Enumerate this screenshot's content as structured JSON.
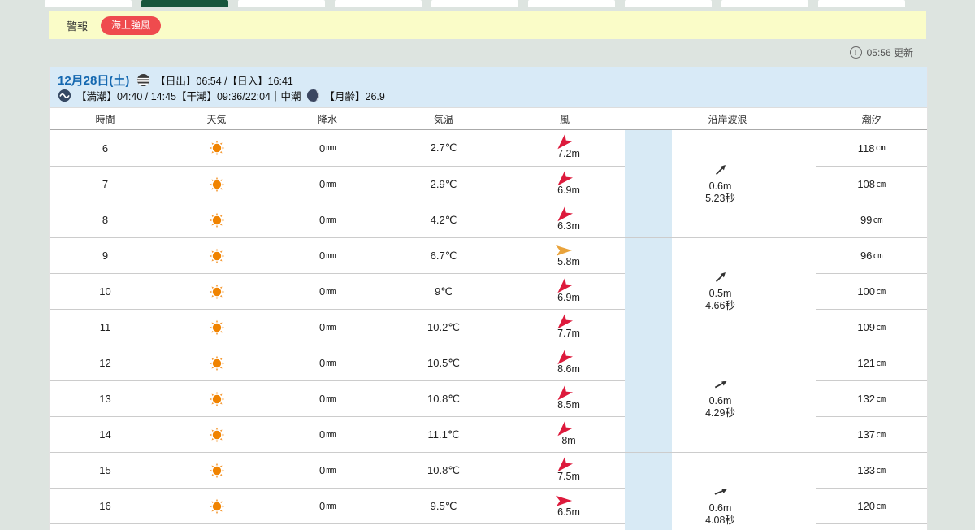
{
  "tabs": {
    "items": [
      {
        "active": false
      },
      {
        "active": true
      },
      {
        "active": false
      },
      {
        "active": false
      },
      {
        "active": false
      },
      {
        "active": false
      },
      {
        "active": false
      },
      {
        "active": false
      },
      {
        "active": false
      }
    ]
  },
  "alert": {
    "label": "警報",
    "badge": "海上強風"
  },
  "update": {
    "text": "05:56 更新"
  },
  "date_header": {
    "date": "12月28日(土)",
    "sun_times": "【日出】06:54 /【日入】16:41",
    "tide_times": "【満潮】04:40 / 14:45【干潮】09:36/22:04｜中潮",
    "moon": "【月齢】26.9"
  },
  "table": {
    "columns": [
      "時間",
      "天気",
      "降水",
      "気温",
      "風",
      "沿岸波浪",
      "潮汐"
    ],
    "rows": [
      {
        "hour": "6",
        "weather": "sunny",
        "precip": "0",
        "precip_unit": "mm",
        "temp": "2.7℃",
        "wind_speed": "7.2m",
        "wind_direction": "southwest",
        "wind_rotate_deg": 135,
        "wind_color": "#dd1a3c",
        "tide": "118",
        "tide_unit": "cm"
      },
      {
        "hour": "7",
        "weather": "sunny",
        "precip": "0",
        "precip_unit": "mm",
        "temp": "2.9℃",
        "wind_speed": "6.9m",
        "wind_direction": "southwest",
        "wind_rotate_deg": 135,
        "wind_color": "#dd1a3c",
        "tide": "108",
        "tide_unit": "cm"
      },
      {
        "hour": "8",
        "weather": "sunny",
        "precip": "0",
        "precip_unit": "mm",
        "temp": "4.2℃",
        "wind_speed": "6.3m",
        "wind_direction": "southwest",
        "wind_rotate_deg": 135,
        "wind_color": "#dd1a3c",
        "tide": "99",
        "tide_unit": "cm"
      },
      {
        "hour": "9",
        "weather": "sunny",
        "precip": "0",
        "precip_unit": "mm",
        "temp": "6.7℃",
        "wind_speed": "5.8m",
        "wind_direction": "east",
        "wind_rotate_deg": 0,
        "wind_color": "#e9a33b",
        "tide": "96",
        "tide_unit": "cm"
      },
      {
        "hour": "10",
        "weather": "sunny",
        "precip": "0",
        "precip_unit": "mm",
        "temp": "9℃",
        "wind_speed": "6.9m",
        "wind_direction": "southwest",
        "wind_rotate_deg": 135,
        "wind_color": "#dd1a3c",
        "tide": "100",
        "tide_unit": "cm"
      },
      {
        "hour": "11",
        "weather": "sunny",
        "precip": "0",
        "precip_unit": "mm",
        "temp": "10.2℃",
        "wind_speed": "7.7m",
        "wind_direction": "southwest",
        "wind_rotate_deg": 135,
        "wind_color": "#dd1a3c",
        "tide": "109",
        "tide_unit": "cm"
      },
      {
        "hour": "12",
        "weather": "sunny",
        "precip": "0",
        "precip_unit": "mm",
        "temp": "10.5℃",
        "wind_speed": "8.6m",
        "wind_direction": "southwest",
        "wind_rotate_deg": 135,
        "wind_color": "#dd1a3c",
        "tide": "121",
        "tide_unit": "cm"
      },
      {
        "hour": "13",
        "weather": "sunny",
        "precip": "0",
        "precip_unit": "mm",
        "temp": "10.8℃",
        "wind_speed": "8.5m",
        "wind_direction": "southwest",
        "wind_rotate_deg": 135,
        "wind_color": "#dd1a3c",
        "tide": "132",
        "tide_unit": "cm"
      },
      {
        "hour": "14",
        "weather": "sunny",
        "precip": "0",
        "precip_unit": "mm",
        "temp": "11.1℃",
        "wind_speed": "8m",
        "wind_direction": "southwest",
        "wind_rotate_deg": 135,
        "wind_color": "#dd1a3c",
        "tide": "137",
        "tide_unit": "cm"
      },
      {
        "hour": "15",
        "weather": "sunny",
        "precip": "0",
        "precip_unit": "mm",
        "temp": "10.8℃",
        "wind_speed": "7.5m",
        "wind_direction": "southwest",
        "wind_rotate_deg": 135,
        "wind_color": "#dd1a3c",
        "tide": "133",
        "tide_unit": "cm"
      },
      {
        "hour": "16",
        "weather": "sunny",
        "precip": "0",
        "precip_unit": "mm",
        "temp": "9.5℃",
        "wind_speed": "6.5m",
        "wind_direction": "east",
        "wind_rotate_deg": 0,
        "wind_color": "#dd1a3c",
        "tide": "120",
        "tide_unit": "cm"
      }
    ],
    "wave_groups": [
      {
        "height": "0.6m",
        "period": "5.23秒",
        "direction": "northeast",
        "angle_deg_from_east": 45
      },
      {
        "height": "0.5m",
        "period": "4.66秒",
        "direction": "northeast",
        "angle_deg_from_east": 45
      },
      {
        "height": "0.6m",
        "period": "4.29秒",
        "direction": "east-northeast",
        "angle_deg_from_east": 28
      },
      {
        "height": "0.6m",
        "period": "4.08秒",
        "direction": "east-northeast",
        "angle_deg_from_east": 22
      }
    ]
  },
  "colors": {
    "accent_red": "#ef4b4e",
    "wind_red": "#dd1a3c",
    "wind_amber": "#e9a33b",
    "sun_orange": "#f08300",
    "strip_blue": "#d8eaf5",
    "date_blue": "#1568b0",
    "banner_yellow": "#fafcc8",
    "tab_green": "#17553c"
  }
}
